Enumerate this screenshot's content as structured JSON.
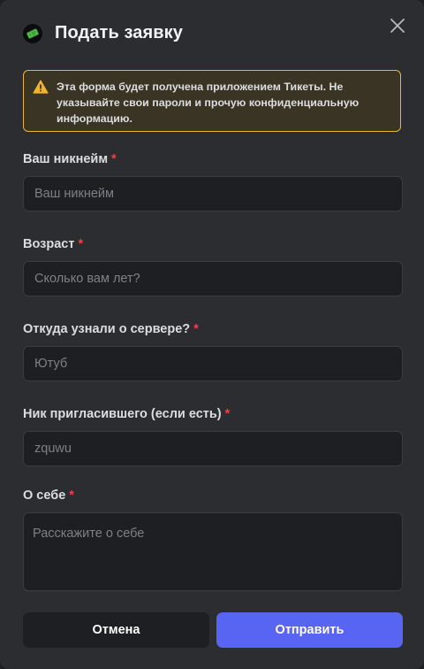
{
  "modal": {
    "title": "Подать заявку",
    "app_icon": "ticket-icon",
    "close_icon": "close-icon"
  },
  "warning": {
    "icon": "warning-icon",
    "text": "Эта форма будет получена приложением Тикеты. Не указывайте свои пароли и прочую конфиденциальную информацию."
  },
  "fields": [
    {
      "label": "Ваш никнейм",
      "required": "*",
      "placeholder": "Ваш никнейм",
      "value": ""
    },
    {
      "label": "Возраст",
      "required": "*",
      "placeholder": "Сколько вам лет?",
      "value": ""
    },
    {
      "label": "Откуда узнали о сервере?",
      "required": "*",
      "placeholder": "Ютуб",
      "value": ""
    },
    {
      "label": "Ник пригласившего (если есть)",
      "required": "*",
      "placeholder": "zquwu",
      "value": ""
    },
    {
      "label": "О себе",
      "required": "*",
      "placeholder": "Расскажите о себе",
      "value": ""
    }
  ],
  "buttons": {
    "cancel_label": "Отмена",
    "submit_label": "Отправить"
  },
  "colors": {
    "accent": "#5865f2",
    "warning_border": "#f0b232",
    "required": "#f23f43"
  }
}
